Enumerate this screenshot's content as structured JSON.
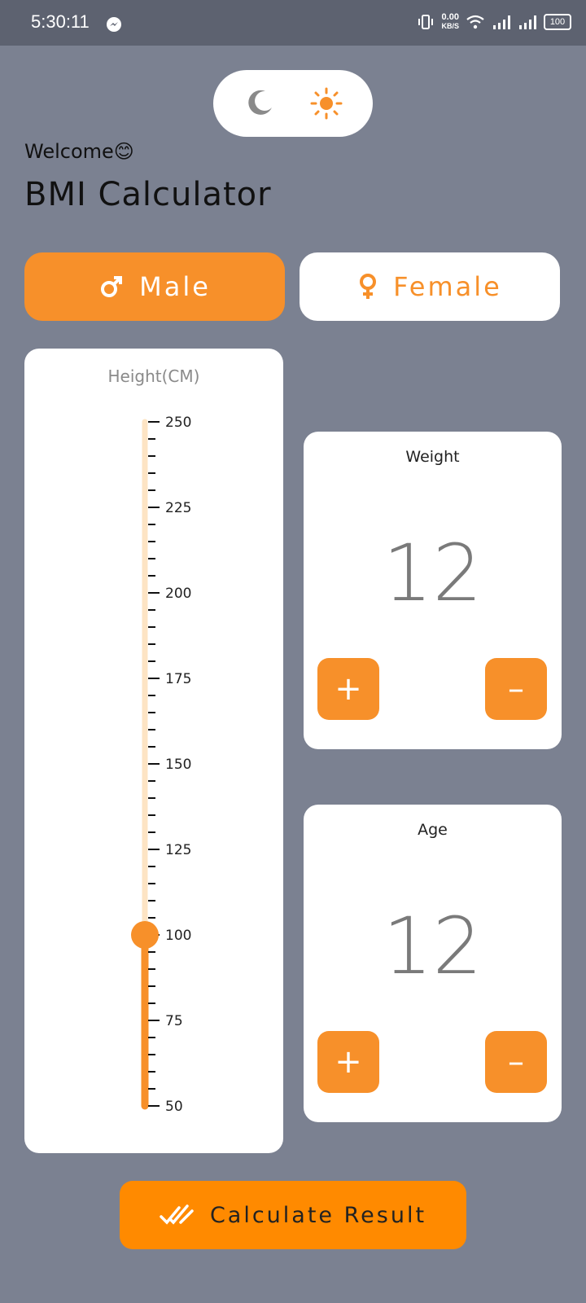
{
  "status_bar": {
    "time": "5:30:11",
    "speed_value": "0.00",
    "speed_unit": "KB/S",
    "battery": "100"
  },
  "theme_toggle": {
    "dark_icon": "moon-icon",
    "light_icon": "sun-icon",
    "selected": "light"
  },
  "header": {
    "welcome": "Welcome😊",
    "title": "BMI Calculator"
  },
  "gender": {
    "male_label": "Male",
    "female_label": "Female",
    "selected": "male",
    "male_icon": "male-symbol-icon",
    "female_icon": "female-symbol-icon"
  },
  "height": {
    "title": "Height(CM)",
    "min": 50,
    "max": 250,
    "value": 100,
    "major_labels": [
      "250",
      "225",
      "200",
      "175",
      "150",
      "125",
      "100",
      "75",
      "50"
    ]
  },
  "weight": {
    "label": "Weight",
    "value": "12",
    "plus": "+",
    "minus": "–"
  },
  "age": {
    "label": "Age",
    "value": "12",
    "plus": "+",
    "minus": "–"
  },
  "calculate": {
    "label": "Calculate Result",
    "icon": "double-check-icon"
  },
  "colors": {
    "accent": "#f7902a",
    "background": "#7b8191",
    "track_light": "#fde4c4"
  }
}
